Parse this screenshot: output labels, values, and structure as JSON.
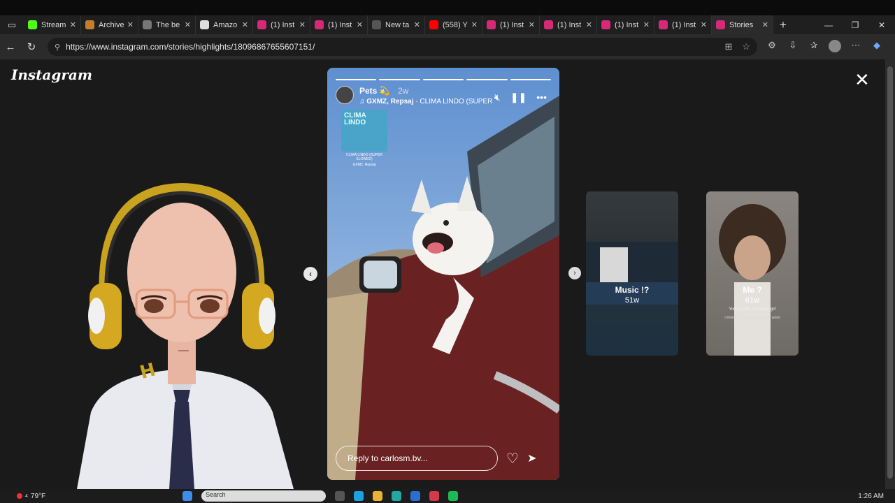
{
  "browser": {
    "tabs": [
      {
        "label": "Stream",
        "favicon": "kick-icon",
        "color": "#53fc18"
      },
      {
        "label": "Archive",
        "favicon": "archive-icon",
        "color": "#c47d2a"
      },
      {
        "label": "The be",
        "favicon": "shield-icon",
        "color": "#777777"
      },
      {
        "label": "Amazo",
        "favicon": "amazon-icon",
        "color": "#dddddd"
      },
      {
        "label": "(1) Inst",
        "favicon": "instagram-icon",
        "color": "#d62976"
      },
      {
        "label": "(1) Inst",
        "favicon": "instagram-icon",
        "color": "#d62976"
      },
      {
        "label": "New ta",
        "favicon": "newtab-icon",
        "color": "#555555"
      },
      {
        "label": "(558) Y",
        "favicon": "youtube-icon",
        "color": "#ff0000"
      },
      {
        "label": "(1) Inst",
        "favicon": "instagram-icon",
        "color": "#d62976"
      },
      {
        "label": "(1) Inst",
        "favicon": "instagram-icon",
        "color": "#d62976"
      },
      {
        "label": "(1) Inst",
        "favicon": "instagram-icon",
        "color": "#d62976"
      },
      {
        "label": "(1) Inst",
        "favicon": "instagram-icon",
        "color": "#d62976"
      },
      {
        "label": "Stories",
        "favicon": "instagram-icon",
        "color": "#d62976",
        "active": true
      }
    ],
    "url": "https://www.instagram.com/stories/highlights/18096867655607151/"
  },
  "instagram": {
    "logo": "Instagram",
    "story": {
      "title": "Pets",
      "emoji": "💫",
      "ago": "2w",
      "song_artist": "GXMZ, Repsaj",
      "song_title": "CLIMA LINDO (SUPER",
      "sticker_cover_text": "CLIMA LINDO",
      "sticker_caption": "CLIMA LINDO (SUPER SLOWED)",
      "sticker_artist": "GXMZ, Repsaj",
      "progress_segments": 5,
      "progress_done": 5,
      "reply_placeholder": "Reply to carlosm.bv..."
    },
    "side_cards": [
      {
        "label": "Music !?",
        "age": "51w"
      },
      {
        "label": "Me ?",
        "age": "61w",
        "sub1": "You're such a strange girl",
        "sub2": "I think you come from another world"
      }
    ]
  },
  "taskbar": {
    "weather": "79°F",
    "weather_badge": "4",
    "search_placeholder": "Search",
    "time": "1:26 AM"
  }
}
